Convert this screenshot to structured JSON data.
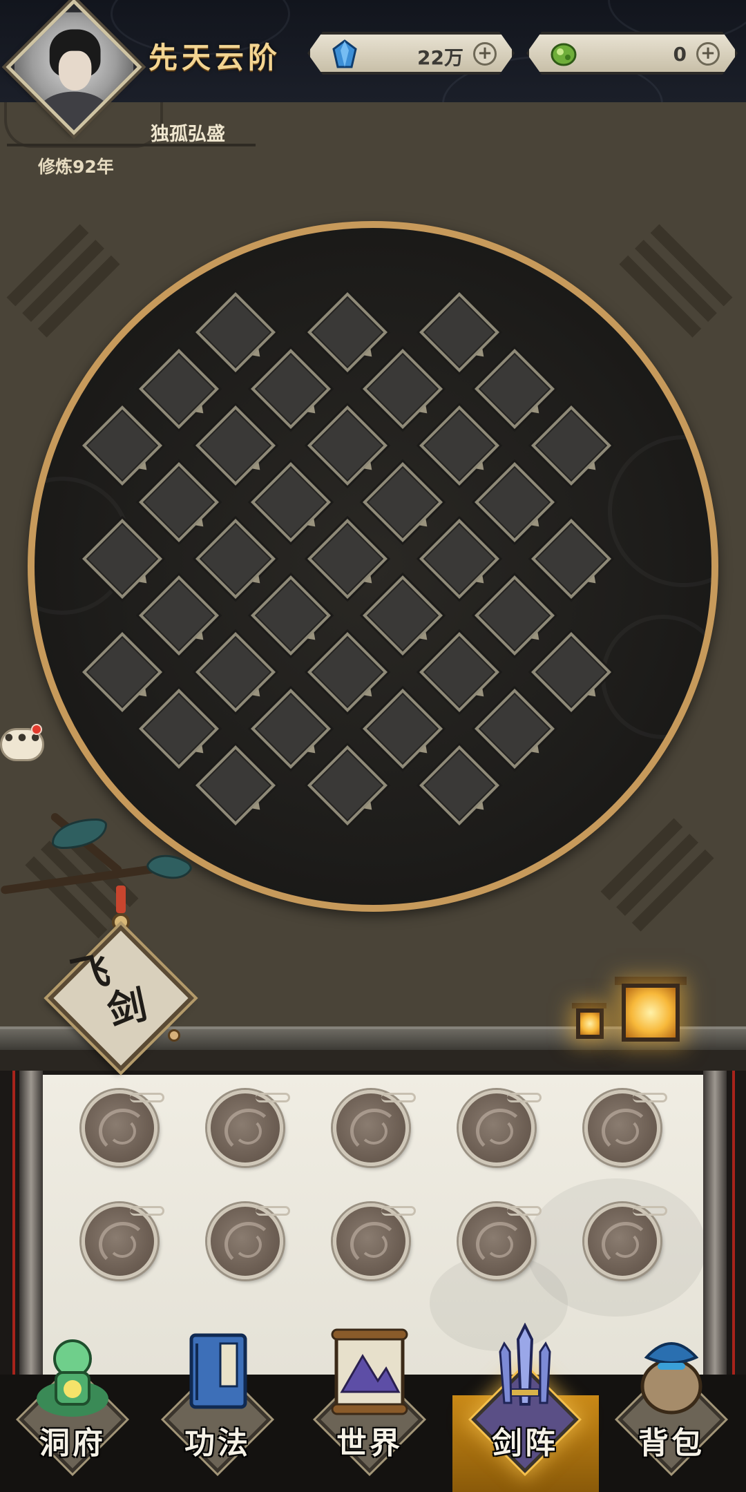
{
  "header": {
    "realm_title": "先天云阶",
    "resources": [
      {
        "name": "spirit-crystal",
        "value": "22万",
        "icon": "blue-crystal-icon",
        "color": "#3d8fd6"
      },
      {
        "name": "jade",
        "value": "0",
        "icon": "green-jade-icon",
        "color": "#6fae3a"
      }
    ],
    "plus_label": "+"
  },
  "player": {
    "name": "独孤弘盛",
    "cultivation": "修炼92年"
  },
  "board": {
    "slot_count": 41,
    "ring_color": "#c79a5b"
  },
  "chat": {
    "label": "•••",
    "has_notification": true
  },
  "sword_tag": {
    "chars": [
      "飞",
      "剑"
    ]
  },
  "inventory": {
    "rows": 2,
    "cols": 5
  },
  "nav": {
    "active_index": 3,
    "items": [
      {
        "label": "洞府",
        "icon": "cave-dwelling-icon"
      },
      {
        "label": "功法",
        "icon": "scripture-book-icon"
      },
      {
        "label": "世界",
        "icon": "world-map-scroll-icon"
      },
      {
        "label": "剑阵",
        "icon": "sword-formation-icon"
      },
      {
        "label": "背包",
        "icon": "backpack-icon"
      }
    ],
    "active_color": "#c98917"
  }
}
